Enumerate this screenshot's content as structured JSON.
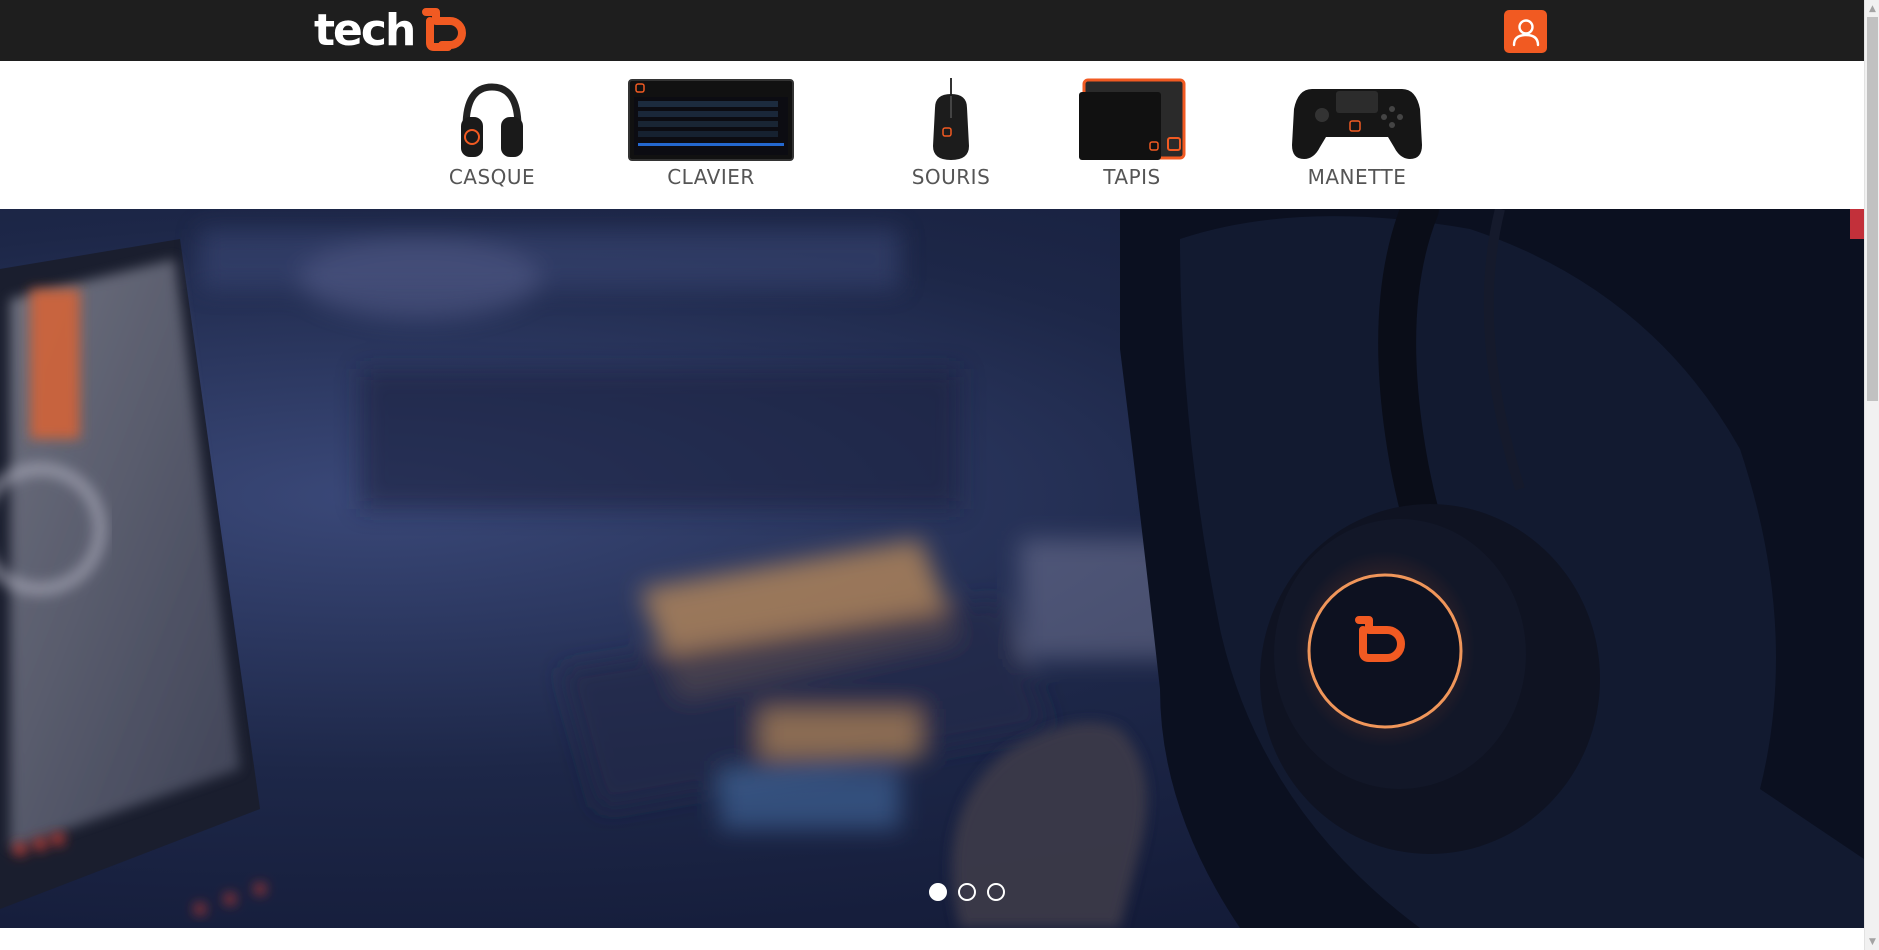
{
  "header": {
    "logo_text": "tech",
    "brand_color": "#f15a22",
    "user_icon": "user-icon"
  },
  "categories": [
    {
      "label": "CASQUE",
      "icon": "headset-icon"
    },
    {
      "label": "CLAVIER",
      "icon": "keyboard-icon"
    },
    {
      "label": "SOURIS",
      "icon": "mouse-icon"
    },
    {
      "label": "TAPIS",
      "icon": "mousepad-icon"
    },
    {
      "label": "MANETTE",
      "icon": "gamepad-icon"
    }
  ],
  "carousel": {
    "slide_count": 3,
    "active_index": 0
  },
  "colors": {
    "topbar": "#1e1e1e",
    "accent": "#f15a22",
    "nav_text": "#555555"
  }
}
